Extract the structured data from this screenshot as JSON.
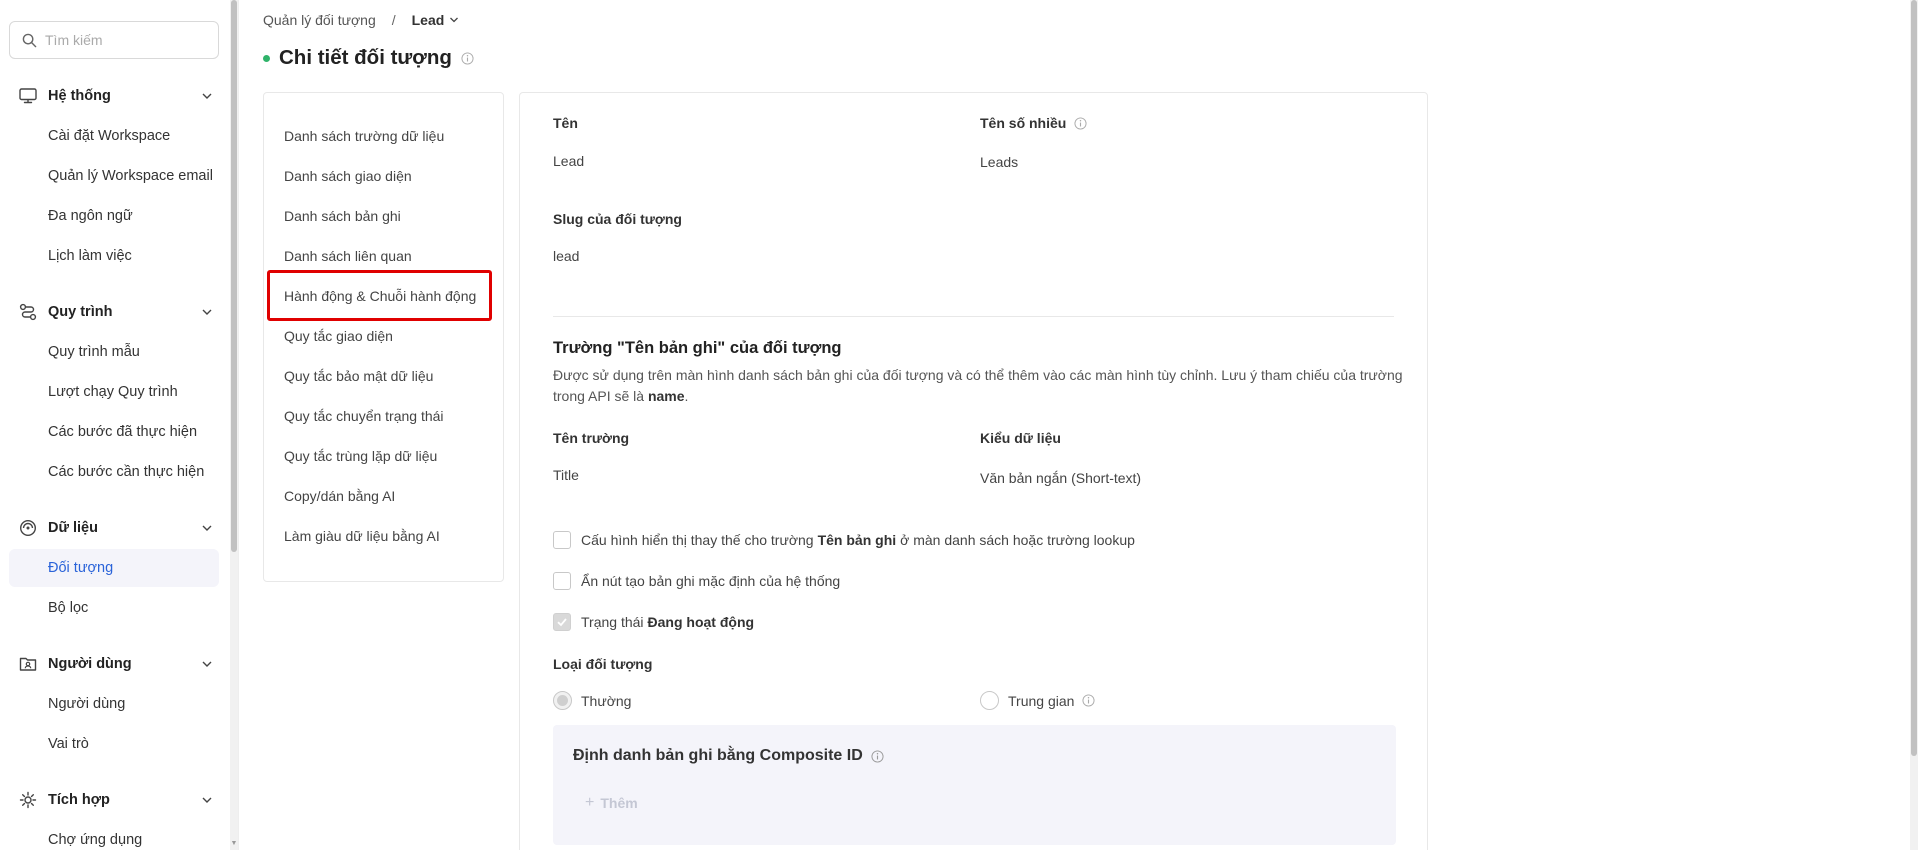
{
  "search": {
    "placeholder": "Tìm kiếm"
  },
  "sidebar": {
    "groups": [
      {
        "label": "Hệ thống",
        "items": [
          "Cài đặt Workspace",
          "Quản lý Workspace email",
          "Đa ngôn ngữ",
          "Lịch làm việc"
        ]
      },
      {
        "label": "Quy trình",
        "items": [
          "Quy trình mẫu",
          "Lượt chạy Quy trình",
          "Các bước đã thực hiện",
          "Các bước cần thực hiện"
        ]
      },
      {
        "label": "Dữ liệu",
        "items": [
          "Đối tượng",
          "Bộ lọc"
        ]
      },
      {
        "label": "Người dùng",
        "items": [
          "Người dùng",
          "Vai trò"
        ]
      },
      {
        "label": "Tích hợp",
        "items": [
          "Chợ ứng dụng"
        ]
      }
    ],
    "active_item": "Đối tượng"
  },
  "breadcrumb": {
    "parent": "Quản lý đối tượng",
    "separator": "/",
    "current": "Lead"
  },
  "page": {
    "title": "Chi tiết đối tượng",
    "status_color": "#2fb36a"
  },
  "detail_menu": {
    "items": [
      "Danh sách trường dữ liệu",
      "Danh sách giao diện",
      "Danh sách bản ghi",
      "Danh sách liên quan",
      "Hành động & Chuỗi hành động",
      "Quy tắc giao diện",
      "Quy tắc bảo mật dữ liệu",
      "Quy tắc chuyển trạng thái",
      "Quy tắc trùng lặp dữ liệu",
      "Copy/dán bằng AI",
      "Làm giàu dữ liệu bằng AI"
    ],
    "highlighted": "Hành động & Chuỗi hành động",
    "highlight_color": "#e00000"
  },
  "object": {
    "name_label": "Tên",
    "name_value": "Lead",
    "plural_label": "Tên số nhiều",
    "plural_value": "Leads",
    "slug_label": "Slug của đối tượng",
    "slug_value": "lead"
  },
  "record_name": {
    "title": "Trường \"Tên bản ghi\" của đối tượng",
    "desc_prefix": "Được sử dụng trên màn hình danh sách bản ghi của đối tượng và có thể thêm vào các màn hình tùy chỉnh. Lưu ý tham chiếu của trường trong API sẽ là",
    "desc_key": "name",
    "desc_suffix": ".",
    "field_label": "Tên trường",
    "field_value": "Title",
    "type_label": "Kiểu dữ liệu",
    "type_value": "Văn bản ngắn (Short-text)"
  },
  "options": {
    "opt1_prefix": "Cấu hình hiển thị thay thế cho trường",
    "opt1_bold": "Tên bản ghi",
    "opt1_suffix": "ở màn danh sách hoặc trường lookup",
    "opt1_checked": false,
    "opt2": "Ẩn nút tạo bản ghi mặc định của hệ thống",
    "opt2_checked": false,
    "opt3_prefix": "Trạng thái",
    "opt3_bold": "Đang hoạt động",
    "opt3_checked": true
  },
  "object_type": {
    "label": "Loại đối tượng",
    "options": [
      "Thường",
      "Trung gian"
    ],
    "selected": "Thường"
  },
  "composite": {
    "title": "Định danh bản ghi bằng Composite ID",
    "add_label": "Thêm"
  }
}
